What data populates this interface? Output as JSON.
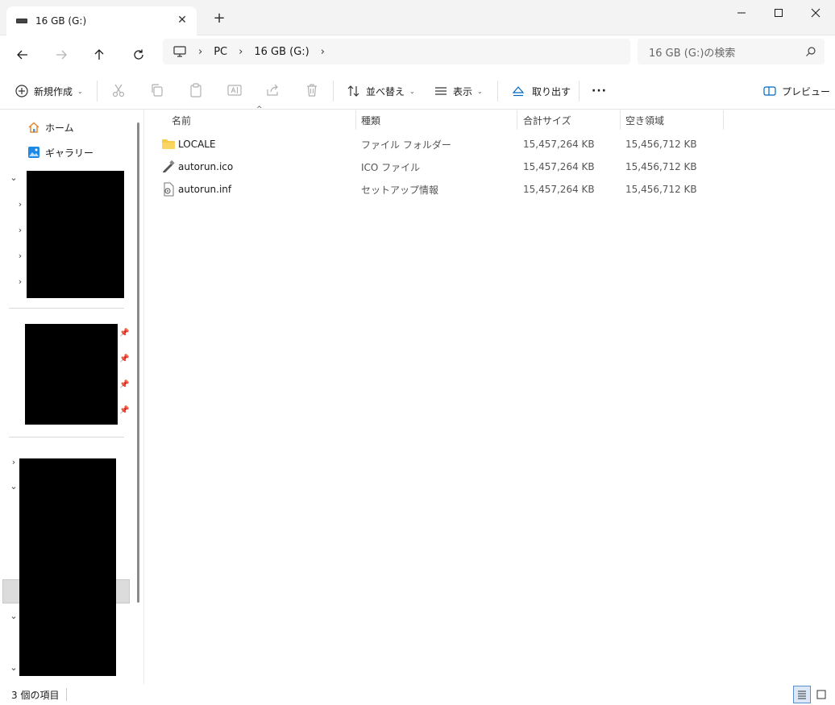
{
  "window": {
    "tab_title": "16 GB (G:)",
    "new_tab": "+",
    "close_tab": "✕"
  },
  "address": {
    "segments": [
      "PC",
      "16 GB (G:)"
    ],
    "search_placeholder": "16 GB (G:)の検索"
  },
  "commands": {
    "new": "新規作成",
    "sort": "並べ替え",
    "view": "表示",
    "eject": "取り出す",
    "more": "···",
    "preview": "プレビュー"
  },
  "sidebar": {
    "items": [
      {
        "label": "ホーム",
        "icon": "home-icon"
      },
      {
        "label": "ギャラリー",
        "icon": "gallery-icon"
      }
    ]
  },
  "columns": {
    "name": "名前",
    "type": "種類",
    "total_size": "合計サイズ",
    "free_space": "空き領域"
  },
  "files": [
    {
      "name": "LOCALE",
      "type": "ファイル フォルダー",
      "total_size": "15,457,264 KB",
      "free_space": "15,456,712 KB",
      "icon": "folder-icon"
    },
    {
      "name": "autorun.ico",
      "type": "ICO ファイル",
      "total_size": "15,457,264 KB",
      "free_space": "15,456,712 KB",
      "icon": "ico-file-icon"
    },
    {
      "name": "autorun.inf",
      "type": "セットアップ情報",
      "total_size": "15,457,264 KB",
      "free_space": "15,456,712 KB",
      "icon": "setup-file-icon"
    }
  ],
  "status": {
    "item_count": "3 個の項目"
  },
  "colors": {
    "accent": "#0067c0",
    "folder": "#f7c948",
    "sidebar_selected": "#dcdcdc"
  }
}
